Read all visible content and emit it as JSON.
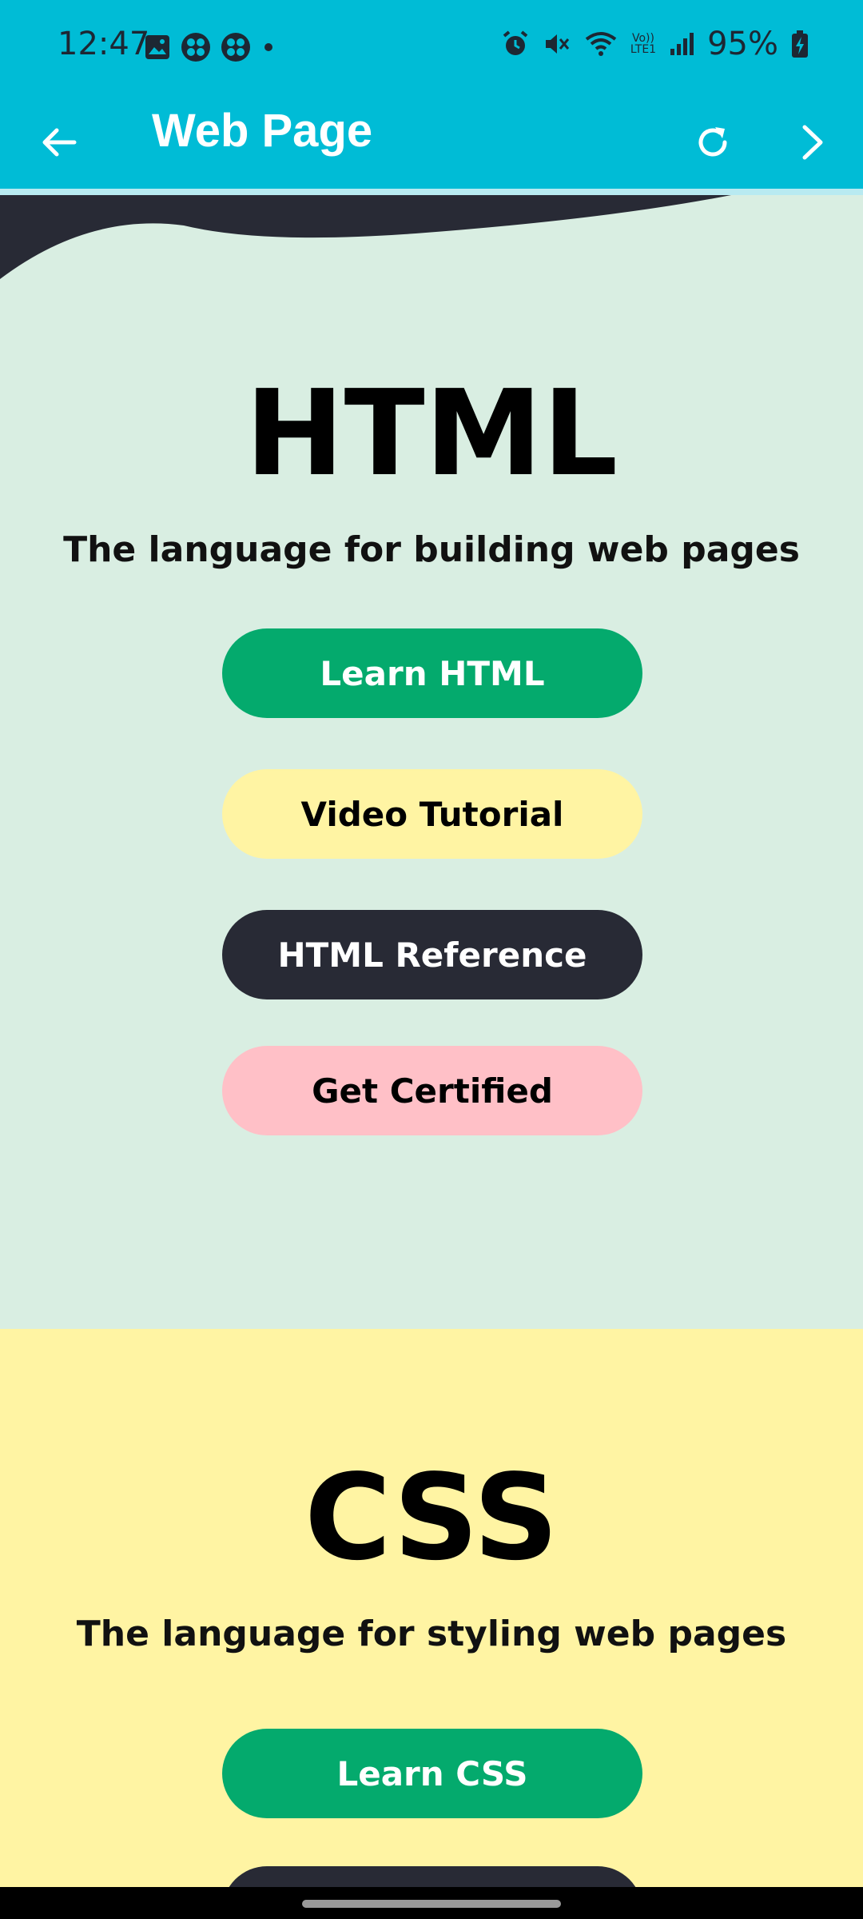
{
  "status_bar": {
    "time": "12:47",
    "battery_pct": "95%",
    "network_label_top": "Vo))",
    "network_label_bottom": "LTE1",
    "icons_left": [
      "image-icon",
      "app-icon",
      "app-icon",
      "dot-icon"
    ],
    "icons_right": [
      "alarm-icon",
      "mute-icon",
      "wifi-icon",
      "signal-icon",
      "battery-charging-icon"
    ]
  },
  "app_bar": {
    "title": "Web Page",
    "back_icon": "back-arrow-icon",
    "reload_icon": "reload-icon",
    "forward_icon": "forward-chevron-icon"
  },
  "html_section": {
    "title": "HTML",
    "subtitle": "The language for building web pages",
    "buttons": [
      {
        "label": "Learn HTML",
        "bg": "#04aa6d",
        "fg": "#ffffff"
      },
      {
        "label": "Video Tutorial",
        "bg": "#fff4a3",
        "fg": "#000000"
      },
      {
        "label": "HTML Reference",
        "bg": "#282a35",
        "fg": "#ffffff"
      },
      {
        "label": "Get Certified",
        "bg": "#ffc0c7",
        "fg": "#000000"
      }
    ]
  },
  "css_section": {
    "title": "CSS",
    "subtitle": "The language for styling web pages",
    "buttons": [
      {
        "label": "Learn CSS",
        "bg": "#04aa6d",
        "fg": "#ffffff"
      },
      {
        "label": "",
        "bg": "#282a35",
        "fg": "#ffffff"
      }
    ]
  },
  "colors": {
    "appbar": "#00bcd6",
    "html_bg": "#d9eee2",
    "css_bg": "#fff4a3",
    "wave_dark": "#282a35"
  }
}
